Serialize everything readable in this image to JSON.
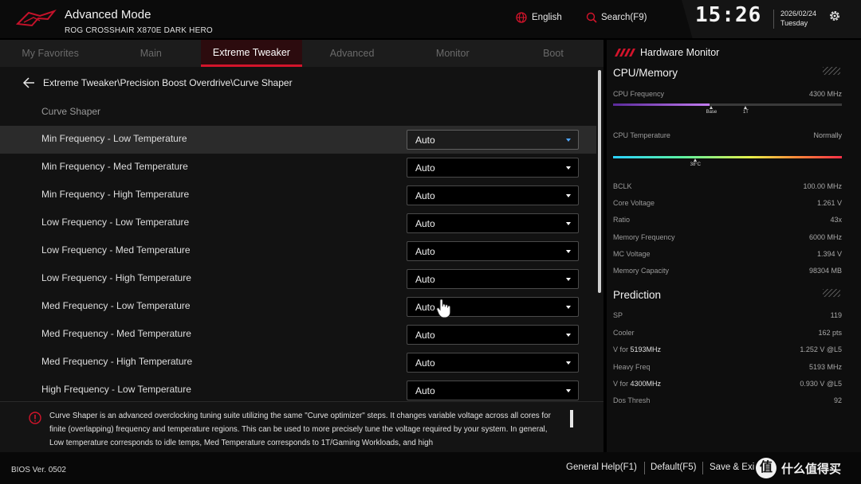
{
  "header": {
    "title": "Advanced Mode",
    "board": "ROG CROSSHAIR X870E DARK HERO",
    "language": "English",
    "search": "Search(F9)",
    "time": "15:26",
    "date": "2026/02/24",
    "day": "Tuesday",
    "icons": {
      "logo": "rog-logo",
      "language": "globe-icon",
      "search": "search-icon",
      "settings": "gear-icon"
    }
  },
  "tabs": [
    {
      "label": "My Favorites"
    },
    {
      "label": "Main"
    },
    {
      "label": "Extreme Tweaker",
      "active": true
    },
    {
      "label": "Advanced"
    },
    {
      "label": "Monitor"
    },
    {
      "label": "Boot"
    }
  ],
  "main": {
    "breadcrumb": "Extreme Tweaker\\Precision Boost Overdrive\\Curve Shaper",
    "section_title": "Curve Shaper",
    "rows": [
      {
        "label": "Min Frequency - Low Temperature",
        "value": "Auto",
        "selected": true
      },
      {
        "label": "Min Frequency - Med Temperature",
        "value": "Auto"
      },
      {
        "label": "Min Frequency - High Temperature",
        "value": "Auto"
      },
      {
        "label": "Low Frequency - Low Temperature",
        "value": "Auto"
      },
      {
        "label": "Low Frequency - Med Temperature",
        "value": "Auto"
      },
      {
        "label": "Low Frequency - High Temperature",
        "value": "Auto"
      },
      {
        "label": "Med Frequency - Low Temperature",
        "value": "Auto"
      },
      {
        "label": "Med Frequency - Med Temperature",
        "value": "Auto"
      },
      {
        "label": "Med Frequency - High Temperature",
        "value": "Auto"
      },
      {
        "label": "High Frequency - Low Temperature",
        "value": "Auto"
      }
    ]
  },
  "help": {
    "text": "Curve Shaper is an advanced overclocking tuning suite utilizing the same \"Curve optimizer\" steps. It changes variable voltage across all cores for finite (overlapping) frequency and temperature regions. This can be used to more precisely tune the voltage required by your system. In general, Low temperature corresponds to idle temps, Med Temperature corresponds to 1T/Gaming Workloads, and high"
  },
  "hardware_monitor": {
    "title": "Hardware Monitor",
    "cpu_memory": {
      "heading": "CPU/Memory",
      "cpu_frequency": {
        "label": "CPU Frequency",
        "value": "4300 MHz",
        "fill": 0.42,
        "markers": [
          {
            "label": "Base",
            "pos": 0.43
          },
          {
            "label": "1T",
            "pos": 0.58
          }
        ]
      },
      "cpu_temperature": {
        "label": "CPU Temperature",
        "value": "Normally",
        "marker": "38°C",
        "pos": 0.36
      },
      "stats": [
        {
          "label": "BCLK",
          "value": "100.00 MHz"
        },
        {
          "label": "Core Voltage",
          "value": "1.261 V"
        },
        {
          "label": "Ratio",
          "value": "43x"
        },
        {
          "label": "Memory Frequency",
          "value": "6000 MHz"
        },
        {
          "label": "MC Voltage",
          "value": "1.394 V"
        },
        {
          "label": "Memory Capacity",
          "value": "98304 MB"
        }
      ]
    },
    "prediction": {
      "heading": "Prediction",
      "stats": [
        {
          "label": "SP",
          "value": "119"
        },
        {
          "label": "Cooler",
          "value": "162 pts"
        },
        {
          "label_prefix": "V for ",
          "label_strong": "5193MHz",
          "value": "1.252 V @L5"
        },
        {
          "label": "Heavy Freq",
          "value": "5193 MHz"
        },
        {
          "label_prefix": "V for ",
          "label_strong": "4300MHz",
          "value": "0.930 V @L5"
        },
        {
          "label": "Dos Thresh",
          "value": "92"
        }
      ]
    }
  },
  "footer": {
    "bios": "BIOS Ver. 0502",
    "general_help": "General Help(F1)",
    "default": "Default(F5)",
    "save_exit": "Save & Exi",
    "watermark_symbol": "值",
    "watermark_text": "什么值得买"
  }
}
